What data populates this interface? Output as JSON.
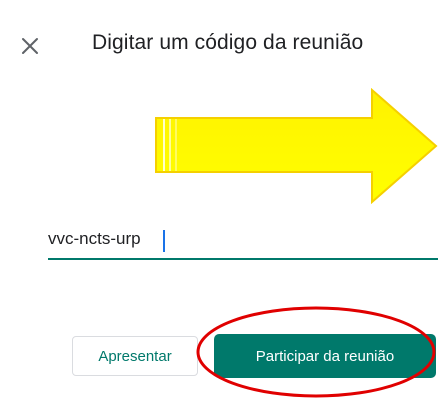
{
  "dialog": {
    "title": "Digitar um código da reunião",
    "close_icon": "close-icon"
  },
  "meeting_code": {
    "value": "vvc-ncts-urp",
    "placeholder": ""
  },
  "actions": {
    "present_label": "Apresentar",
    "join_label": "Participar da reunião"
  },
  "colors": {
    "accent": "#00796b",
    "arrow_fill": "#ffff00",
    "arrow_stroke": "#f2c200",
    "annotation_ellipse": "#e00000"
  }
}
